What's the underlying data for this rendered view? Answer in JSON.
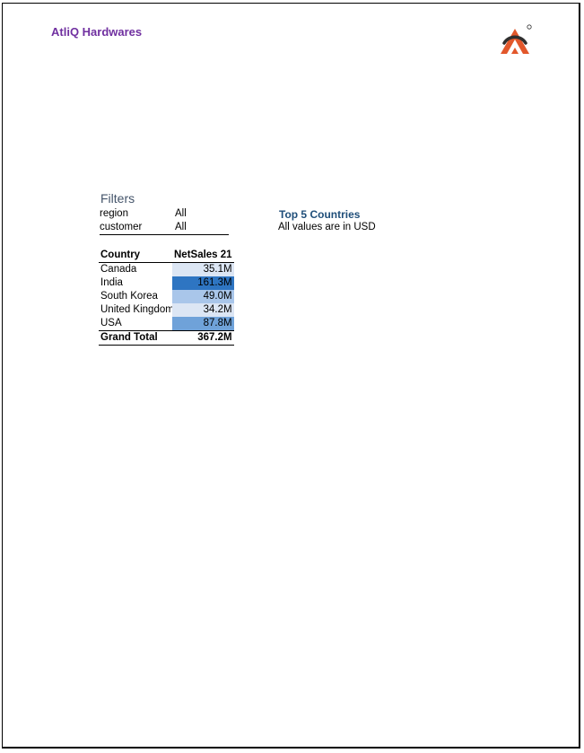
{
  "header": {
    "company": "AtliQ Hardwares",
    "logo_icon": "atliq-logo-icon",
    "brand_color": "#7030a0",
    "logo_colors": [
      "#e2572b",
      "#2f2f2f"
    ]
  },
  "filters": {
    "title": "Filters",
    "items": [
      {
        "key": "region",
        "value": "All"
      },
      {
        "key": "customer",
        "value": "All"
      }
    ]
  },
  "report": {
    "title": "Top 5 Countries",
    "subtitle": "All values are in USD"
  },
  "table": {
    "headers": {
      "country": "Country",
      "sales": "NetSales 21"
    },
    "rows": [
      {
        "country": "Canada",
        "sales": "35.1M",
        "value": 35.1,
        "color": "#dce6f4"
      },
      {
        "country": "India",
        "sales": "161.3M",
        "value": 161.3,
        "color": "#2e75c2"
      },
      {
        "country": "South Korea",
        "sales": "49.0M",
        "value": 49.0,
        "color": "#a9c6ea"
      },
      {
        "country": "United Kingdom",
        "sales": "34.2M",
        "value": 34.2,
        "color": "#dce6f4"
      },
      {
        "country": "USA",
        "sales": "87.8M",
        "value": 87.8,
        "color": "#6fa2d9"
      }
    ],
    "total": {
      "label": "Grand Total",
      "sales": "367.2M"
    }
  }
}
